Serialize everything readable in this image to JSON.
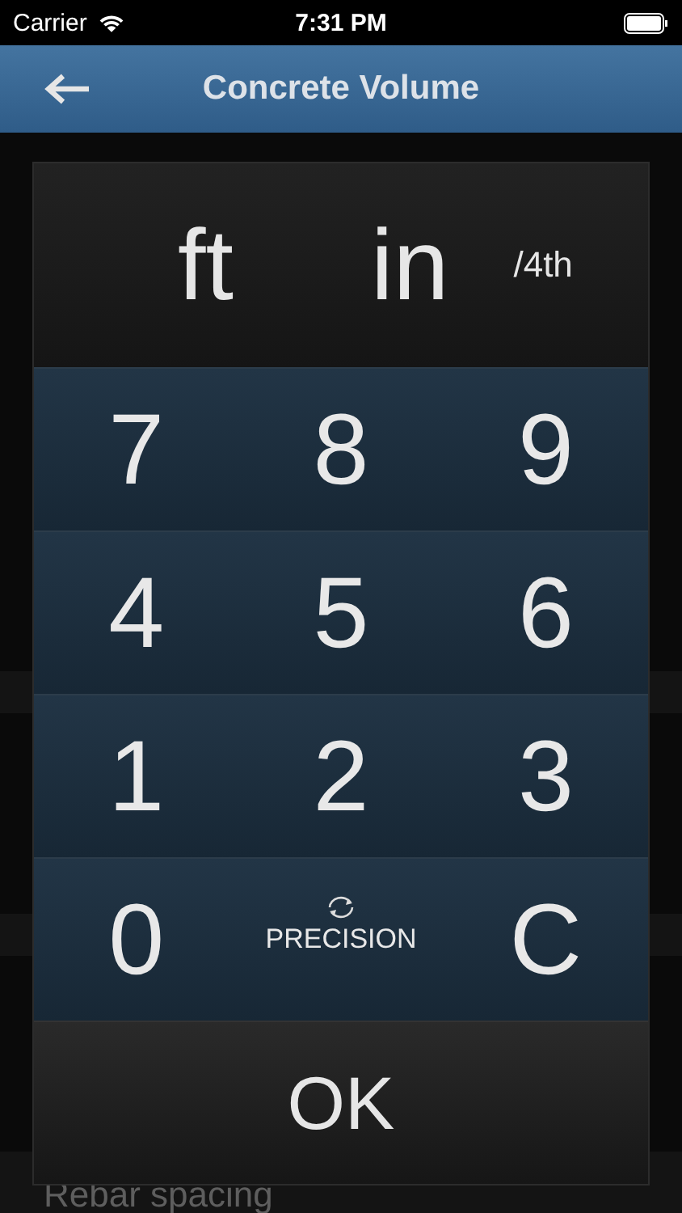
{
  "status_bar": {
    "carrier": "Carrier",
    "time": "7:31 PM"
  },
  "header": {
    "title": "Concrete Volume"
  },
  "background": {
    "label": "Rebar spacing"
  },
  "keypad": {
    "units": [
      {
        "text": "ft",
        "kind": "unit"
      },
      {
        "text": "in",
        "kind": "unit"
      },
      {
        "text": "/4th",
        "kind": "fraction"
      }
    ],
    "keys": [
      {
        "text": "7",
        "kind": "key"
      },
      {
        "text": "8",
        "kind": "key"
      },
      {
        "text": "9",
        "kind": "key"
      },
      {
        "text": "4",
        "kind": "key"
      },
      {
        "text": "5",
        "kind": "key"
      },
      {
        "text": "6",
        "kind": "key"
      },
      {
        "text": "1",
        "kind": "key"
      },
      {
        "text": "2",
        "kind": "key"
      },
      {
        "text": "3",
        "kind": "key"
      },
      {
        "text": "0",
        "kind": "key"
      },
      {
        "text": "C",
        "kind": "key"
      }
    ],
    "precision": "PRECISION",
    "ok": "OK"
  }
}
